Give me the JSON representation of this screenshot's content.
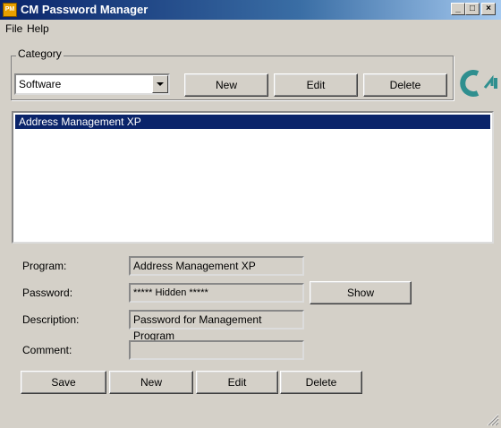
{
  "window": {
    "title": "CM Password Manager",
    "icon_text": "PM"
  },
  "title_buttons": {
    "minimize": "_",
    "maximize": "□",
    "close": "×"
  },
  "menu": {
    "items": [
      "File",
      "Help"
    ]
  },
  "category": {
    "legend": "Category",
    "selected": "Software",
    "new_label": "New",
    "edit_label": "Edit",
    "delete_label": "Delete"
  },
  "list": {
    "items": [
      "Address Management XP"
    ]
  },
  "details": {
    "program_label": "Program:",
    "program_value": "Address Management XP",
    "password_label": "Password:",
    "password_value": "***** Hidden *****",
    "show_label": "Show",
    "description_label": "Description:",
    "description_value": "Password for Management Program",
    "comment_label": "Comment:",
    "comment_value": ""
  },
  "actions": {
    "save_label": "Save",
    "new_label": "New",
    "edit_label": "Edit",
    "delete_label": "Delete"
  },
  "colors": {
    "selection": "#0a246a",
    "logo": "#2f8f8f",
    "face": "#d4d0c8"
  }
}
